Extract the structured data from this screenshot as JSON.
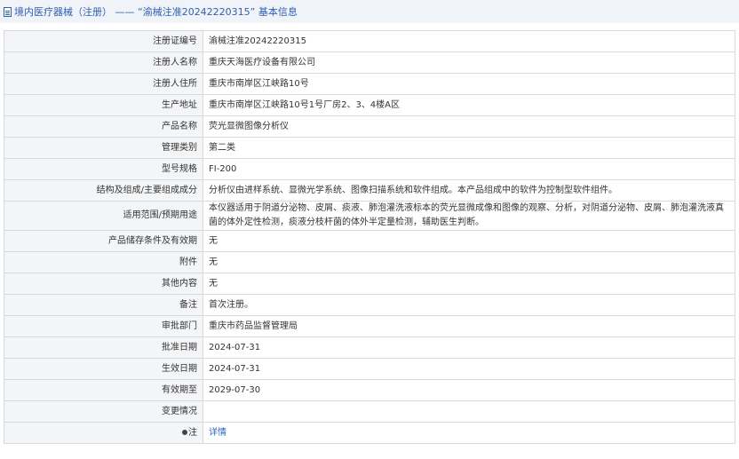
{
  "header": {
    "title": "境内医疗器械（注册） —— “渝械注准20242220315” 基本信息"
  },
  "rows": [
    {
      "label": "注册证编号",
      "value": "渝械注准20242220315"
    },
    {
      "label": "注册人名称",
      "value": "重庆天海医疗设备有限公司"
    },
    {
      "label": "注册人住所",
      "value": "重庆市南岸区江峡路10号"
    },
    {
      "label": "生产地址",
      "value": "重庆市南岸区江峡路10号1号厂房2、3、4楼A区"
    },
    {
      "label": "产品名称",
      "value": "荧光显微图像分析仪"
    },
    {
      "label": "管理类别",
      "value": "第二类"
    },
    {
      "label": "型号规格",
      "value": "FI-200"
    },
    {
      "label": "结构及组成/主要组成成分",
      "value": "分析仪由进样系统、显微光学系统、图像扫描系统和软件组成。本产品组成中的软件为控制型软件组件。"
    },
    {
      "label": "适用范围/预期用途",
      "value": "本仪器适用于阴道分泌物、皮屑、痰液、肺泡灌洗液标本的荧光显微成像和图像的观察、分析，对阴道分泌物、皮屑、肺泡灌洗液真菌的体外定性检测，痰液分枝杆菌的体外半定量检测，辅助医生判断。"
    },
    {
      "label": "产品储存条件及有效期",
      "value": "无"
    },
    {
      "label": "附件",
      "value": "无"
    },
    {
      "label": "其他内容",
      "value": "无"
    },
    {
      "label": "备注",
      "value": "首次注册。"
    },
    {
      "label": "审批部门",
      "value": "重庆市药品监督管理局"
    },
    {
      "label": "批准日期",
      "value": "2024-07-31"
    },
    {
      "label": "生效日期",
      "value": "2024-07-31"
    },
    {
      "label": "有效期至",
      "value": "2029-07-30"
    },
    {
      "label": "变更情况",
      "value": ""
    },
    {
      "label": "注",
      "value": "详情"
    }
  ],
  "icons": {
    "header_icon": "document-icon",
    "note_icon": "pin-icon"
  },
  "colors": {
    "link": "#2a62c2",
    "header_text": "#2f5fb0",
    "label_bg": "#f4f5f7"
  }
}
